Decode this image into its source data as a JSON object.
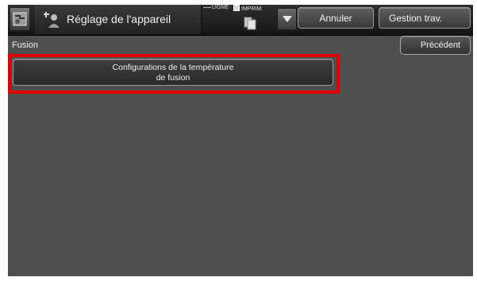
{
  "header": {
    "title": "Réglage de l'appareil",
    "mode_ligne": "LIGNE",
    "mode_imprim": "IMPRIM.",
    "cancel_label": "Annuler",
    "job_status_label": "Gestion trav."
  },
  "subheader": {
    "title": "Fusion",
    "back_label": "Précédent"
  },
  "menu": {
    "item_line1": "Configurations de la température",
    "item_line2": "de fusion"
  },
  "colors": {
    "highlight": "#e00000",
    "background": "#4f4f4f"
  },
  "icons": [
    "settings-app-icon",
    "device-settings-icon",
    "printer-icon",
    "chevron-down-icon"
  ]
}
